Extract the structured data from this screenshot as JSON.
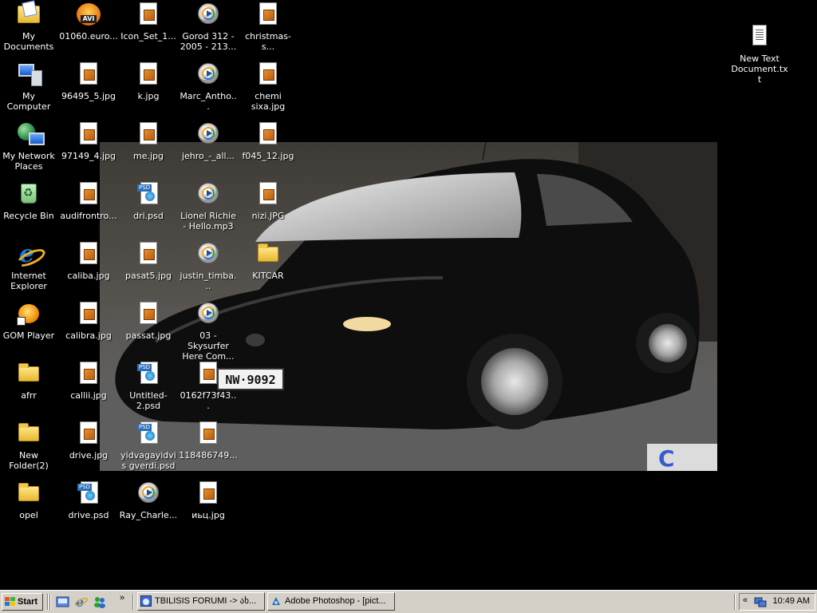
{
  "desktop": {
    "icons": [
      {
        "label": "My Documents",
        "icon": "my-documents-icon"
      },
      {
        "label": "01060.euro...",
        "icon": "avi-video-icon"
      },
      {
        "label": "Icon_Set_1...",
        "icon": "image-file-icon"
      },
      {
        "label": "Gorod 312 - 2005 - 213...",
        "icon": "media-file-icon"
      },
      {
        "label": "christmas-s...",
        "icon": "image-file-icon"
      },
      {
        "label": "New Text Document.txt",
        "icon": "text-file-icon"
      },
      {
        "label": "My Computer",
        "icon": "my-computer-icon"
      },
      {
        "label": "96495_5.jpg",
        "icon": "image-file-icon"
      },
      {
        "label": "k.jpg",
        "icon": "image-file-icon"
      },
      {
        "label": "Marc_Antho...",
        "icon": "media-file-icon"
      },
      {
        "label": "chemi sixa.jpg",
        "icon": "image-file-icon"
      },
      {
        "label": "My Network Places",
        "icon": "network-places-icon"
      },
      {
        "label": "97149_4.jpg",
        "icon": "image-file-icon"
      },
      {
        "label": "me.jpg",
        "icon": "image-file-icon"
      },
      {
        "label": "jehro_-_all...",
        "icon": "media-file-icon"
      },
      {
        "label": "f045_12.jpg",
        "icon": "image-file-icon"
      },
      {
        "label": "Recycle Bin",
        "icon": "recycle-bin-icon"
      },
      {
        "label": "audifrontro...",
        "icon": "image-file-icon"
      },
      {
        "label": "dri.psd",
        "icon": "psd-file-icon"
      },
      {
        "label": "Lionel Richie - Hello.mp3",
        "icon": "media-file-icon"
      },
      {
        "label": "nizi.JPG",
        "icon": "image-file-icon"
      },
      {
        "label": "Internet Explorer",
        "icon": "internet-explorer-icon"
      },
      {
        "label": "caliba.jpg",
        "icon": "image-file-icon"
      },
      {
        "label": "pasat5.jpg",
        "icon": "image-file-icon"
      },
      {
        "label": "justin_timba...",
        "icon": "media-file-icon"
      },
      {
        "label": "KITCAR",
        "icon": "folder-icon"
      },
      {
        "label": "GOM Player",
        "icon": "gom-player-icon"
      },
      {
        "label": "calibra.jpg",
        "icon": "image-file-icon"
      },
      {
        "label": "passat.jpg",
        "icon": "image-file-icon"
      },
      {
        "label": "03 - Skysurfer Here Com...",
        "icon": "media-file-icon"
      },
      {
        "label": "afrr",
        "icon": "folder-icon"
      },
      {
        "label": "callii.jpg",
        "icon": "image-file-icon"
      },
      {
        "label": "Untitled-2.psd",
        "icon": "psd-file-icon"
      },
      {
        "label": "0162f73f43...",
        "icon": "image-file-icon"
      },
      {
        "label": "New Folder(2)",
        "icon": "folder-icon"
      },
      {
        "label": "drive.jpg",
        "icon": "image-file-icon"
      },
      {
        "label": "yidvagayidvis gverdi.psd",
        "icon": "psd-file-icon"
      },
      {
        "label": "118486749...",
        "icon": "image-file-icon"
      },
      {
        "label": "opel",
        "icon": "folder-icon"
      },
      {
        "label": "drive.psd",
        "icon": "psd-file-icon"
      },
      {
        "label": "Ray_Charle...",
        "icon": "media-file-icon"
      },
      {
        "label": "иьц.jpg",
        "icon": "image-file-icon"
      }
    ],
    "wallpaper": {
      "plate_text": "NW·9092"
    }
  },
  "taskbar": {
    "start_label": "Start",
    "quick_launch_chevron": "»",
    "tasks": [
      {
        "label": "TBILISIS FORUMI -> ახ...",
        "icon": "browser-window-icon"
      },
      {
        "label": "Adobe Photoshop - [pict...",
        "icon": "photoshop-icon"
      }
    ],
    "tray_expand": "«",
    "clock": "10:49 AM"
  },
  "colors": {
    "desktop_background": "#000000",
    "taskbar": "#d4d0c8"
  }
}
